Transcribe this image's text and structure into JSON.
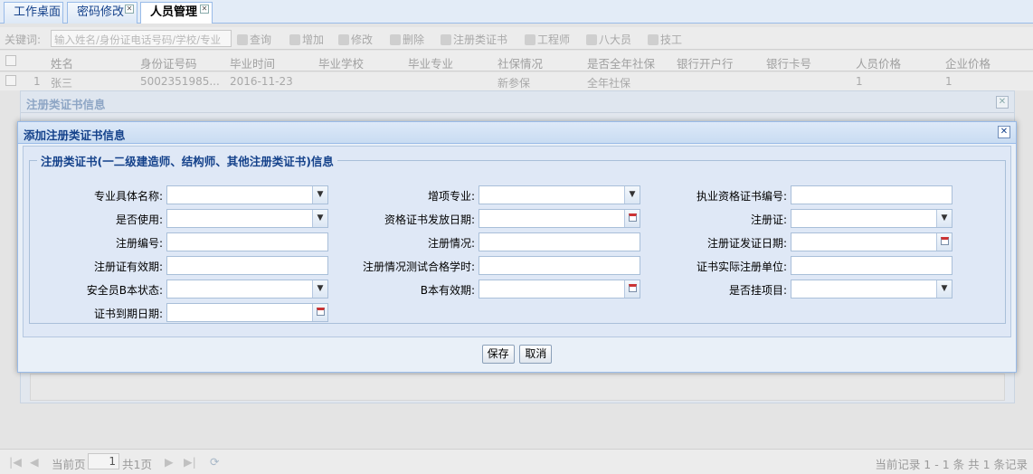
{
  "tabs": [
    {
      "label": "工作桌面",
      "closable": false
    },
    {
      "label": "密码修改",
      "closable": true
    },
    {
      "label": "人员管理",
      "closable": true
    }
  ],
  "toolbar": {
    "keyword_label": "关键词:",
    "search_placeholder": "输入姓名/身份证电话号码/学校/专业",
    "buttons": [
      "查询",
      "增加",
      "修改",
      "删除",
      "注册类证书",
      "工程师",
      "八大员",
      "技工"
    ]
  },
  "grid": {
    "columns": [
      "姓名",
      "身份证号码",
      "毕业时间",
      "毕业学校",
      "毕业专业",
      "社保情况",
      "是否全年社保",
      "银行开户行",
      "银行卡号",
      "人员价格",
      "企业价格"
    ],
    "rows": [
      {
        "index": "1",
        "cells": [
          "张三",
          "5002351985...",
          "2016-11-23",
          "",
          "",
          "新参保",
          "全年社保",
          "",
          "",
          "1",
          "1"
        ]
      }
    ]
  },
  "window_behind": {
    "title": "注册类证书信息"
  },
  "dialog": {
    "title": "添加注册类证书信息",
    "legend": "注册类证书(一二级建造师、结构师、其他注册类证书)信息",
    "fields": [
      {
        "label": "专业具体名称:",
        "type": "select",
        "value": ""
      },
      {
        "label": "增项专业:",
        "type": "select",
        "value": ""
      },
      {
        "label": "执业资格证书编号:",
        "type": "text",
        "value": ""
      },
      {
        "label": "是否使用:",
        "type": "select",
        "value": ""
      },
      {
        "label": "资格证书发放日期:",
        "type": "date",
        "value": ""
      },
      {
        "label": "注册证:",
        "type": "select",
        "value": ""
      },
      {
        "label": "注册编号:",
        "type": "text",
        "value": ""
      },
      {
        "label": "注册情况:",
        "type": "text",
        "value": ""
      },
      {
        "label": "注册证发证日期:",
        "type": "date",
        "value": ""
      },
      {
        "label": "注册证有效期:",
        "type": "text",
        "value": ""
      },
      {
        "label": "注册情况测试合格学时:",
        "type": "text",
        "value": ""
      },
      {
        "label": "证书实际注册单位:",
        "type": "text",
        "value": ""
      },
      {
        "label": "安全员B本状态:",
        "type": "select",
        "value": ""
      },
      {
        "label": "B本有效期:",
        "type": "date",
        "value": ""
      },
      {
        "label": "是否挂项目:",
        "type": "select",
        "value": ""
      },
      {
        "label": "证书到期日期:",
        "type": "date",
        "value": ""
      }
    ],
    "save_label": "保存",
    "cancel_label": "取消"
  },
  "pager": {
    "current_page_label": "当前页",
    "current_page": "1",
    "total_pages": "共1页",
    "summary": "当前记录 1 - 1 条 共 1 条记录"
  },
  "colors": {
    "accent": "#15428b",
    "border": "#99bbe8",
    "dialog_bg": "#dfe8f6"
  }
}
